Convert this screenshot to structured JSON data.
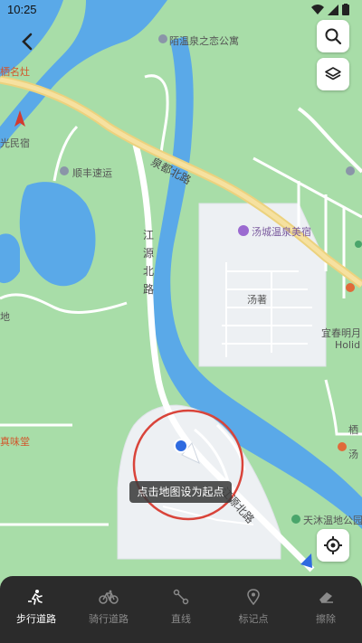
{
  "status_bar": {
    "time": "10:25"
  },
  "map": {
    "pois": [
      {
        "label": "陌温泉之恋公寓",
        "style": "poi"
      },
      {
        "label": "栖名灶",
        "style": "poi-orange"
      },
      {
        "label": "光民宿",
        "style": "poi"
      },
      {
        "label": "顺丰速运",
        "style": "poi"
      },
      {
        "label": "汤城温泉美宿",
        "style": "poi-purple"
      },
      {
        "label": "汤著",
        "style": "poi"
      },
      {
        "label": "宜春明月",
        "style": "poi"
      },
      {
        "label": "Holid",
        "style": "poi"
      },
      {
        "label": "真味堂",
        "style": "poi-orange"
      },
      {
        "label": "栖",
        "style": "poi"
      },
      {
        "label": "汤",
        "style": "poi"
      },
      {
        "label": "天沐温地公园",
        "style": "poi"
      },
      {
        "label": "地",
        "style": "poi"
      }
    ],
    "roads": {
      "quandu_north": "泉都北路",
      "jiangyuan_north": "江源北路",
      "jiangyuan_north_lower": "江源北路"
    }
  },
  "toast": {
    "text": "点击地图设为起点"
  },
  "toolbar": {
    "tools": [
      {
        "label": "步行道路",
        "icon": "walking-icon",
        "active": true
      },
      {
        "label": "骑行道路",
        "icon": "bicycle-icon",
        "active": false
      },
      {
        "label": "直线",
        "icon": "line-icon",
        "active": false
      },
      {
        "label": "标记点",
        "icon": "pin-icon",
        "active": false
      },
      {
        "label": "擦除",
        "icon": "eraser-icon",
        "active": false
      }
    ]
  },
  "colors": {
    "land": "#a9dea9",
    "water": "#5aa9e8",
    "road_main": "#f3d68a",
    "block": "#eef0f3",
    "accent_circle": "#d9443a"
  }
}
